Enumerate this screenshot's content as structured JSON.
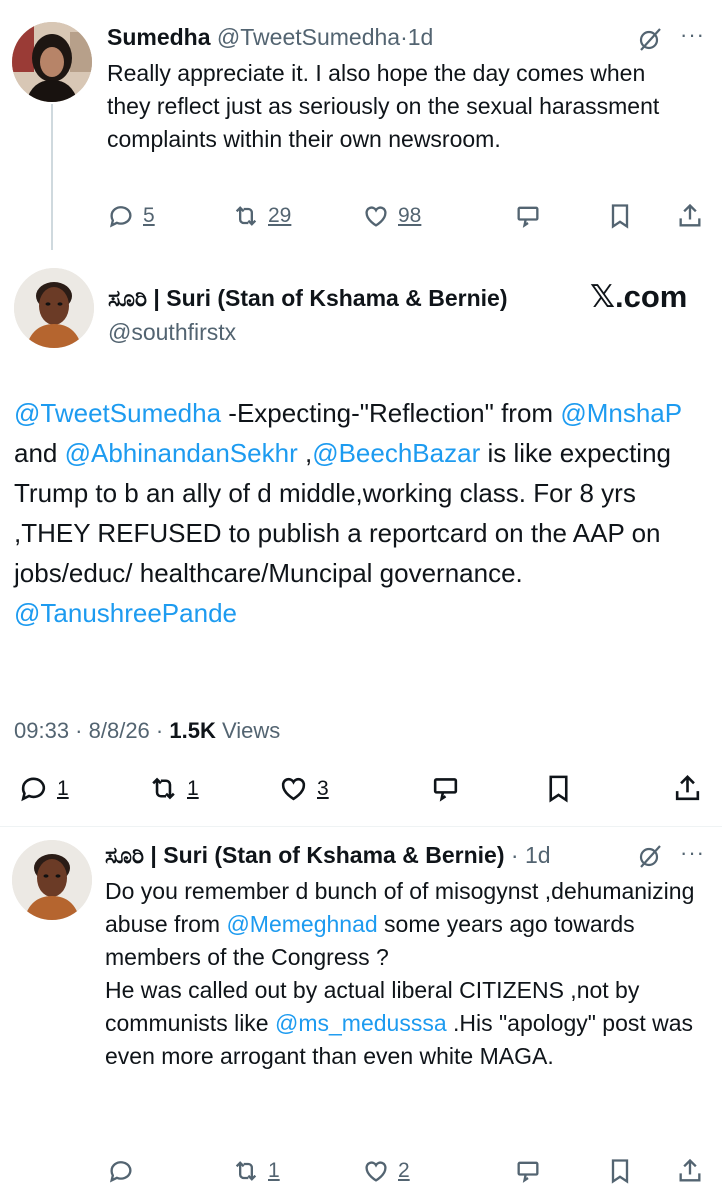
{
  "reply1": {
    "name": "Sumedha",
    "handle": "@TweetSumedha",
    "dot": "·",
    "time": "1d",
    "text": "Really appreciate it. I also hope the day comes when they reflect just as seriously on the sexual harassment complaints within their own newsroom.",
    "replies": "5",
    "reposts": "29",
    "likes": "98"
  },
  "main": {
    "name": "ಸೂರಿ | Suri (Stan of Kshama & Bernie)",
    "handle": "@southfirstx",
    "logo_x": "𝕏",
    "logo_text": ".com",
    "mention1": "@TweetSumedha",
    "text1": " -Expecting-\"Reflection\" from ",
    "mention2": "@MnshaP",
    "text2": " and ",
    "mention3": "@AbhinandanSekhr",
    "text3": " ,",
    "mention4": "@BeechBazar",
    "text4": " is like expecting Trump to b an ally of  d middle,working class.  For 8 yrs ,THEY REFUSED to publish a reportcard on the AAP on jobs/educ/ healthcare/Muncipal governance.",
    "mention5": "@TanushreePande",
    "time": "09:33",
    "date": "8/8/26",
    "views_count": "1.5K",
    "views_label": "Views",
    "replies": "1",
    "reposts": "1",
    "likes": "3"
  },
  "reply2": {
    "name": "ಸೂರಿ | Suri (Stan of Kshama & Bernie)",
    "dot": "·",
    "time": "1d",
    "text1": "Do you remember d bunch of of misogynst ,dehumanizing abuse from ",
    "mention1": "@Memeghnad",
    "text2": " some years ago  towards members of the Congress ?",
    "text3": "He was called out by actual liberal CITIZENS ,not by communists like ",
    "mention2": "@ms_medusssa",
    "text4": " .His \"apology\" post was even more arrogant  than even white MAGA.",
    "reposts": "1",
    "likes": "2"
  },
  "icons": {
    "reply": "reply-icon",
    "repost": "repost-icon",
    "like": "like-icon",
    "grok": "grok-icon",
    "bookmark": "bookmark-icon",
    "share": "share-icon",
    "more": "more-icon"
  },
  "colors": {
    "link": "#1d9bf0",
    "muted": "#536471",
    "text": "#0f1419"
  }
}
